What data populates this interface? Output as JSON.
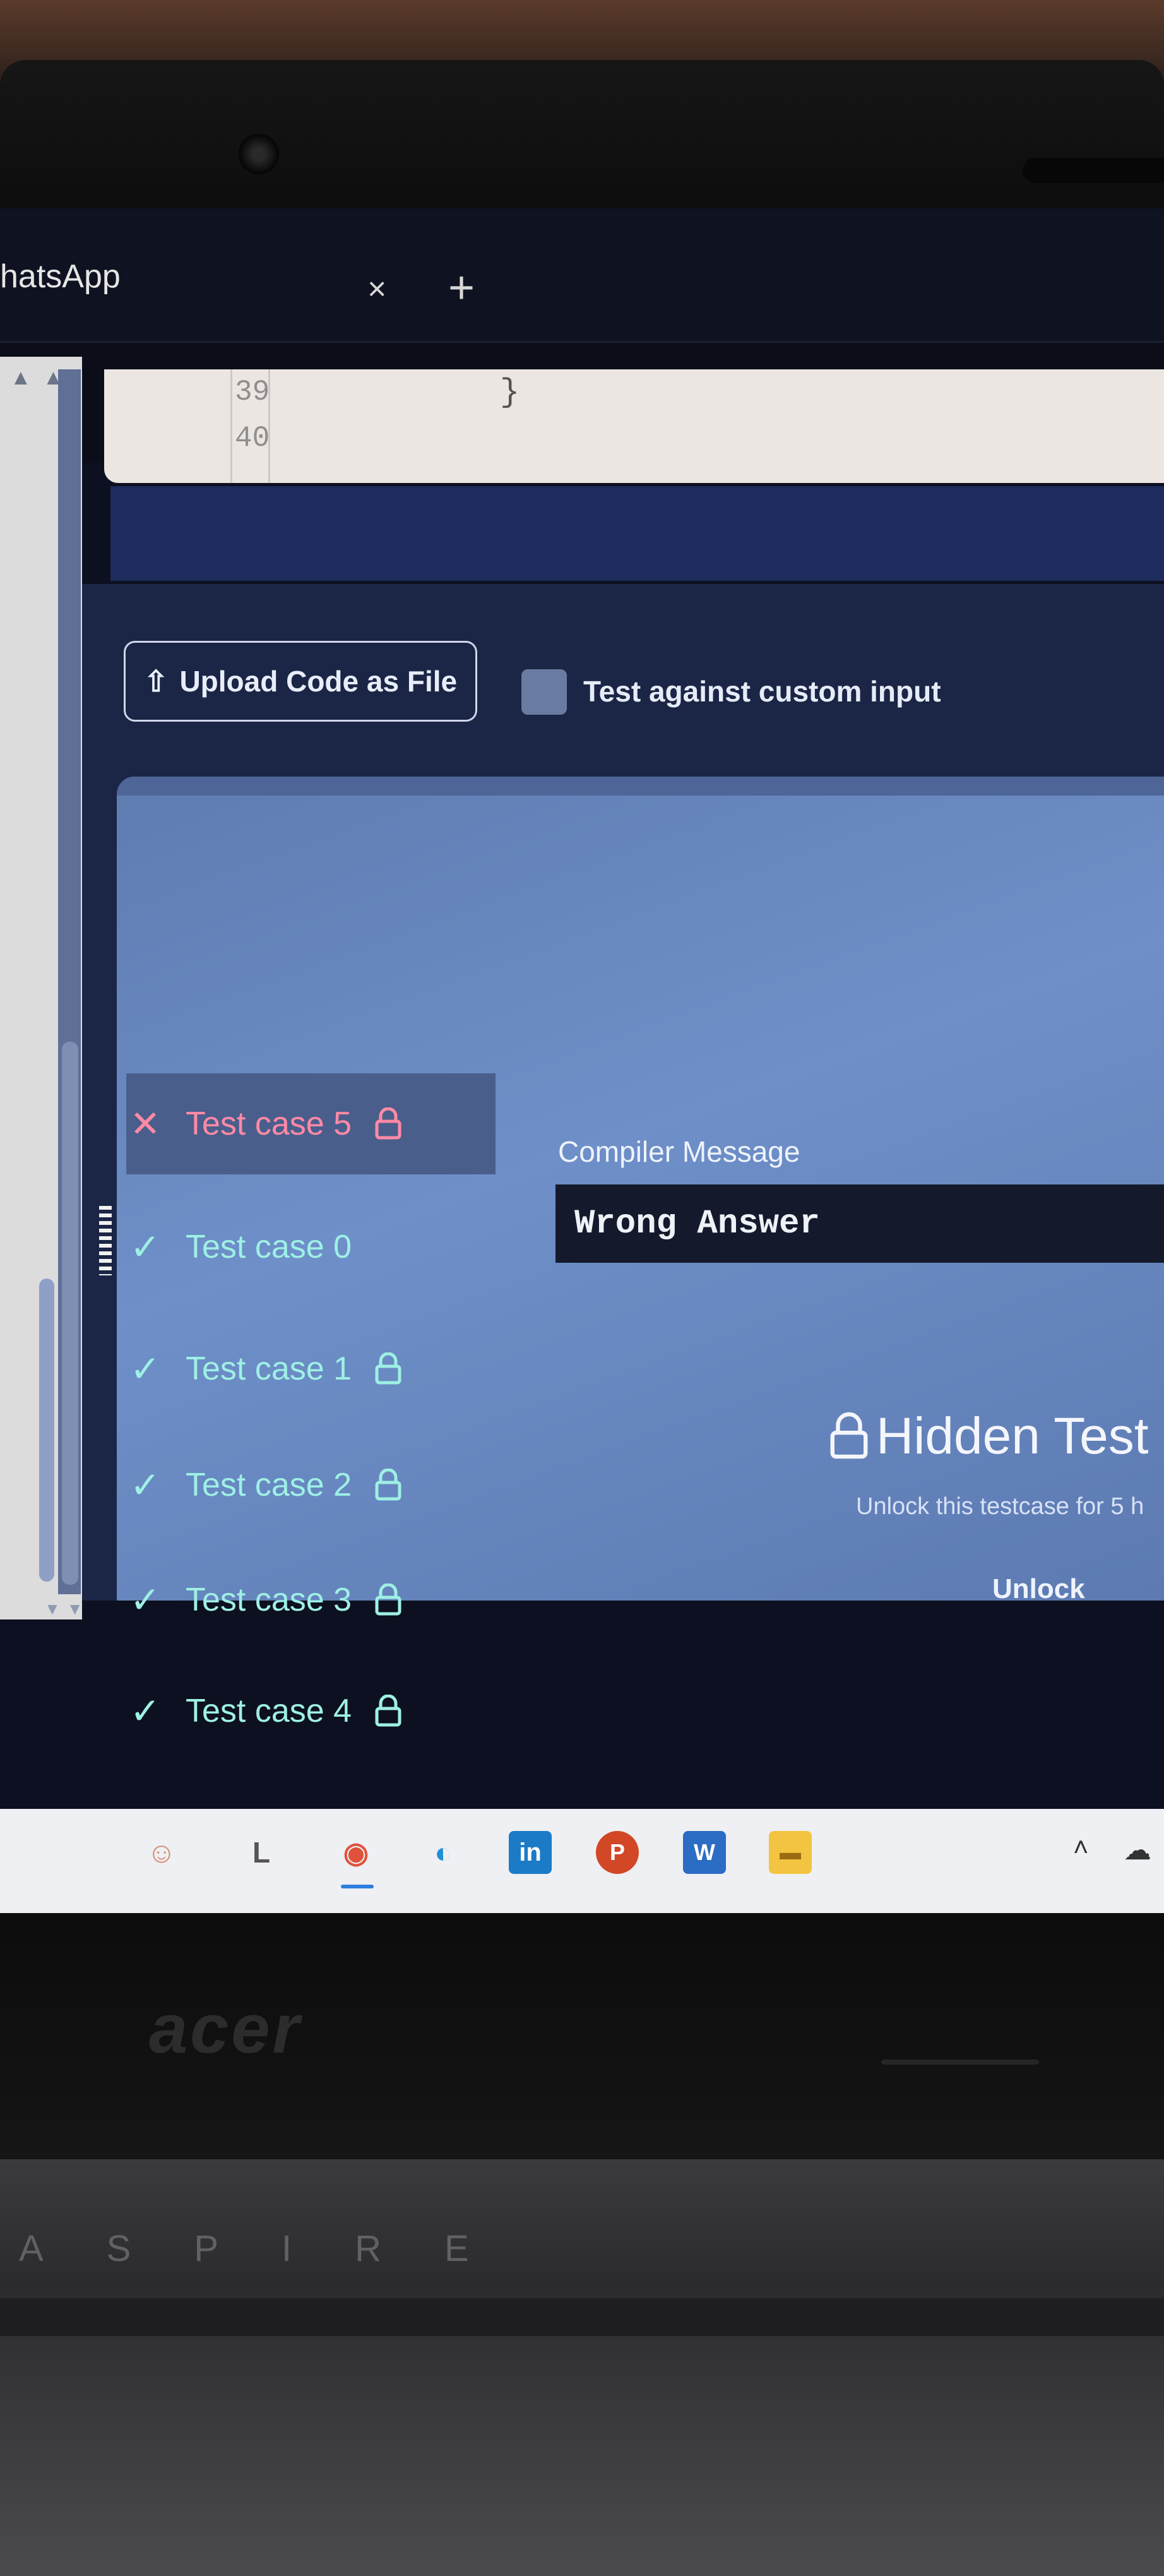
{
  "browser": {
    "tab_title": "hatsApp",
    "close_symbol": "×",
    "new_tab_symbol": "+"
  },
  "editor": {
    "lines": [
      {
        "number": "39",
        "code": "}"
      },
      {
        "number": "40",
        "code": ""
      }
    ]
  },
  "toolbar": {
    "upload_label": "Upload Code as File",
    "custom_input_label": "Test against custom input",
    "custom_input_checked": false
  },
  "test_cases": [
    {
      "label": "Test case 5",
      "status": "failed",
      "locked": true,
      "selected": true
    },
    {
      "label": "Test case 0",
      "status": "passed",
      "locked": false,
      "selected": false
    },
    {
      "label": "Test case 1",
      "status": "passed",
      "locked": true,
      "selected": false
    },
    {
      "label": "Test case 2",
      "status": "passed",
      "locked": true,
      "selected": false
    },
    {
      "label": "Test case 3",
      "status": "passed",
      "locked": true,
      "selected": false
    },
    {
      "label": "Test case 4",
      "status": "passed",
      "locked": true,
      "selected": false
    }
  ],
  "result": {
    "compiler_message_label": "Compiler Message",
    "compiler_message": "Wrong Answer",
    "hidden_title": "Hidden Test",
    "hidden_subtitle": "Unlock this testcase for 5 h",
    "unlock_label": "Unlock"
  },
  "hardware": {
    "brand": "acer",
    "model_letters": "ASPIRE"
  },
  "colors": {
    "fail": "#ff8aa5",
    "pass": "#9ef0e4",
    "panel": "#6e8fc8"
  },
  "taskbar": {
    "icons": [
      "user-avatar-icon",
      "l-app-icon",
      "chrome-icon",
      "edge-icon",
      "linkedin-icon",
      "powerpoint-icon",
      "word-icon",
      "file-explorer-icon"
    ]
  }
}
